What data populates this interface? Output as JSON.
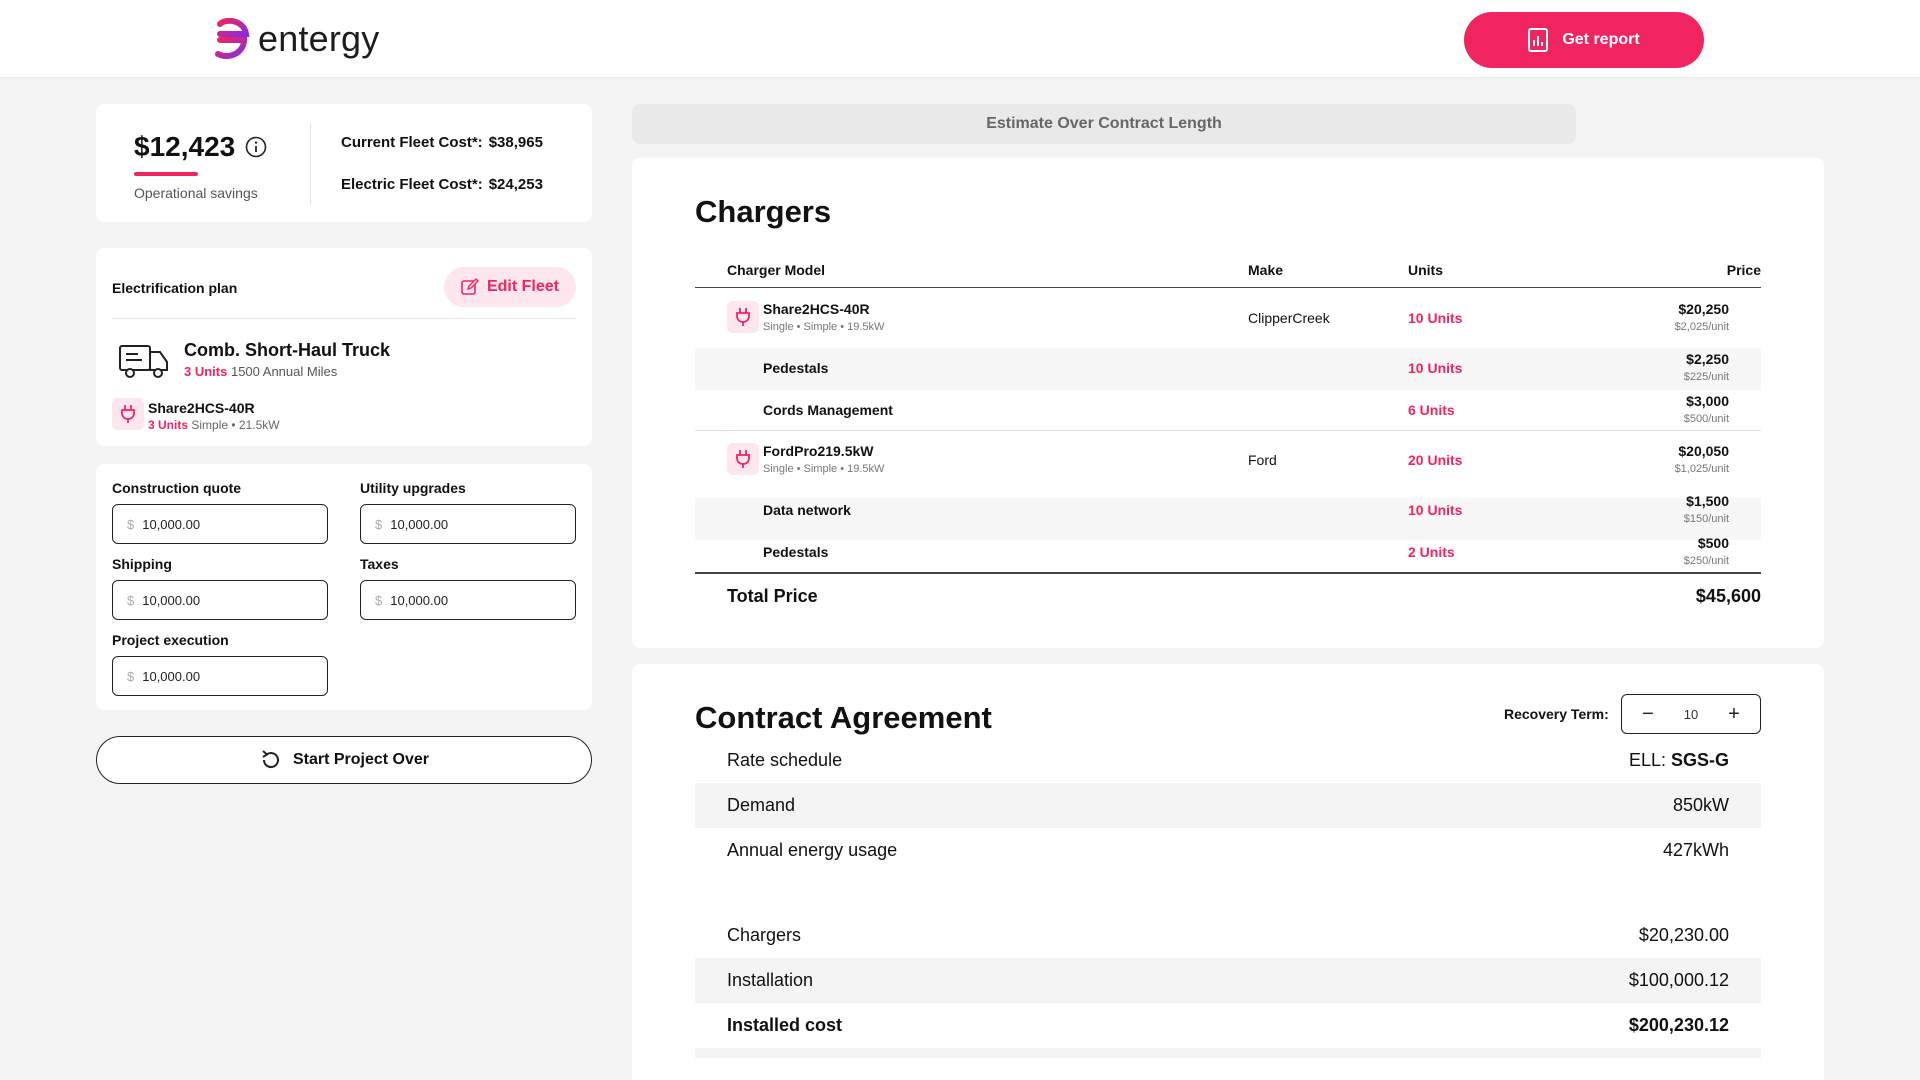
{
  "header": {
    "brand": "entergy",
    "report_label": "Get report",
    "colors": {
      "accent": "#f0245e",
      "accent_soft": "#fde6ee"
    }
  },
  "savings": {
    "amount": "$12,423",
    "label": "Operational savings",
    "current_label": "Current Fleet Cost*:",
    "current_value": "$38,965",
    "electric_label": "Electric Fleet Cost*:",
    "electric_value": "$24,253"
  },
  "plan": {
    "title": "Electrification plan",
    "edit_label": "Edit Fleet",
    "vehicle_name": "Comb. Short-Haul Truck",
    "vehicle_units": "3 Units",
    "vehicle_miles": "1500 Annual Miles",
    "charger_name": "Share2HCS-40R",
    "charger_units": "3 Units",
    "charger_meta": "Simple • 21.5kW"
  },
  "quotes": {
    "construction_label": "Construction quote",
    "construction_value": "10,000.00",
    "utility_label": "Utility upgrades",
    "utility_value": "10,000.00",
    "shipping_label": "Shipping",
    "shipping_value": "10,000.00",
    "taxes_label": "Taxes",
    "taxes_value": "10,000.00",
    "execution_label": "Project execution",
    "execution_value": "10,000.00",
    "currency": "$"
  },
  "start_over_label": "Start Project Over",
  "estimate_label": "Estimate Over Contract Length",
  "chargers": {
    "title": "Chargers",
    "headers": {
      "model": "Charger Model",
      "make": "Make",
      "units": "Units",
      "price": "Price"
    },
    "rows": [
      {
        "name": "Share2HCS-40R",
        "meta": "Single • Simple • 19.5kW",
        "make": "ClipperCreek",
        "units": "10 Units",
        "price": "$20,250",
        "unit_price": "$2,025/unit"
      },
      {
        "name": "Pedestals",
        "units": "10 Units",
        "price": "$2,250",
        "unit_price": "$225/unit"
      },
      {
        "name": "Cords Management",
        "units": "6 Units",
        "price": "$3,000",
        "unit_price": "$500/unit"
      },
      {
        "name": "FordPro219.5kW",
        "meta": "Single • Simple • 19.5kW",
        "make": "Ford",
        "units": "20 Units",
        "price": "$20,050",
        "unit_price": "$1,025/unit"
      },
      {
        "name": "Data network",
        "units": "10 Units",
        "price": "$1,500",
        "unit_price": "$150/unit"
      },
      {
        "name": "Pedestals",
        "units": "2 Units",
        "price": "$500",
        "unit_price": "$250/unit"
      }
    ],
    "total_label": "Total Price",
    "total_value": "$45,600"
  },
  "contract": {
    "title": "Contract Agreement",
    "term_label": "Recovery Term:",
    "term_value": "10",
    "rate_label": "Rate schedule",
    "rate_prefix": "ELL:",
    "rate_value": "SGS-G",
    "demand_label": "Demand",
    "demand_value": "850kW",
    "energy_label": "Annual energy usage",
    "energy_value": "427kWh",
    "chargers_label": "Chargers",
    "chargers_value": "$20,230.00",
    "installation_label": "Installation",
    "installation_value": "$100,000.12",
    "installed_label": "Installed cost",
    "installed_value": "$200,230.12"
  }
}
